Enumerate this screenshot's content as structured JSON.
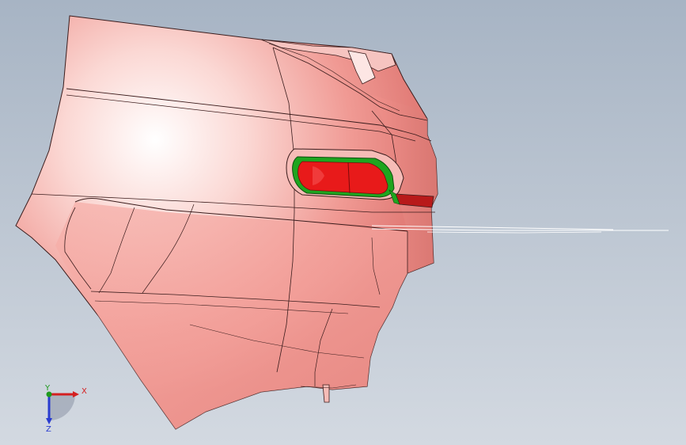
{
  "viewport": {
    "background_top": "#a7b4c4",
    "background_bottom": "#d3d9e1"
  },
  "model": {
    "part": "rear-bumper-corner",
    "body_color": "#f08a86",
    "highlight_color": "#ffffff",
    "edge_color": "#3a1c1c",
    "lamp_color": "#e81a1a",
    "lamp_bezel_color": "#1fa51f"
  },
  "triad": {
    "x_label": "X",
    "y_label": "Y",
    "z_label": "Z",
    "x_color": "#d42020",
    "y_color": "#1e9a1e",
    "z_color": "#2a3cd0"
  }
}
